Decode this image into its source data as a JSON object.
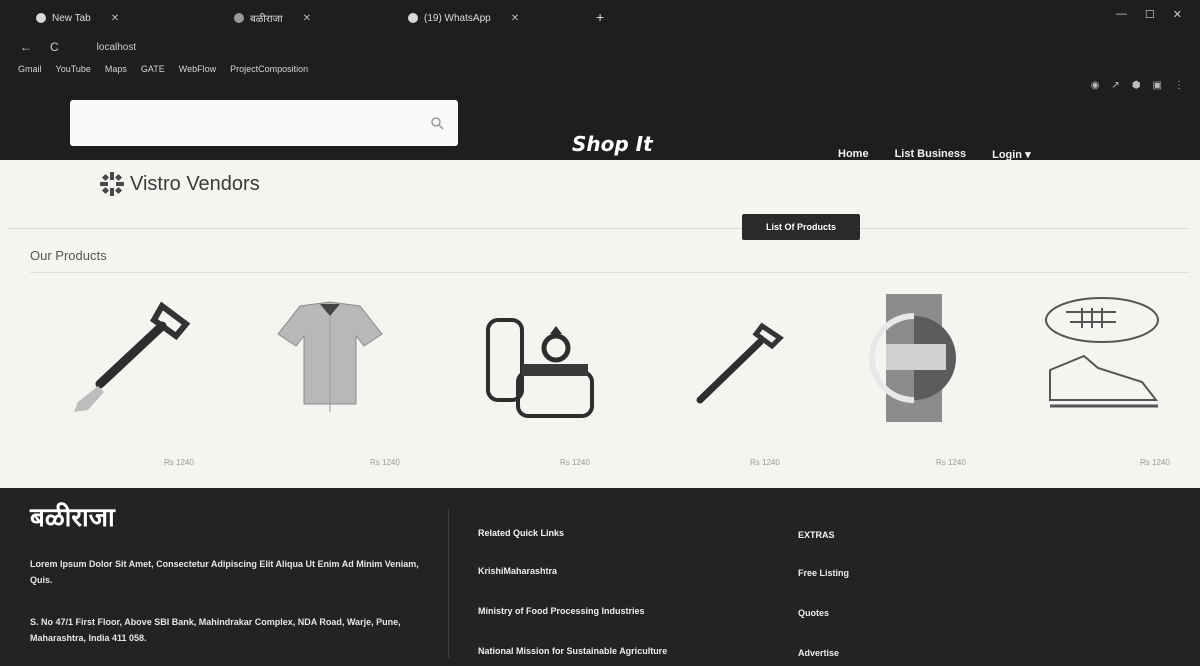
{
  "browser": {
    "tabs": [
      {
        "label": "New Tab"
      },
      {
        "label": "बळीराजा"
      },
      {
        "label": "(19) WhatsApp"
      }
    ],
    "url": "localhost",
    "bookmarks": [
      "Gmail",
      "YouTube",
      "Maps",
      "GATE",
      "WebFlow",
      "ProjectComposition"
    ]
  },
  "site": {
    "search_placeholder": "",
    "brand": "Shop It",
    "nav": {
      "home": "Home",
      "list_business": "List Business",
      "login": "Login ▾"
    },
    "logo_name": "Vistro Vendors",
    "list_products_btn": "List Of Products",
    "section_title": "Our Products"
  },
  "products": [
    {
      "icon": "shovel-icon",
      "name": "",
      "price": "Rs 1240"
    },
    {
      "icon": "shirt-icon",
      "name": "",
      "price": "Rs 1240"
    },
    {
      "icon": "ring-box-icon",
      "name": "",
      "price": "Rs 1240"
    },
    {
      "icon": "shovel-icon",
      "name": "",
      "price": "Rs 1240"
    },
    {
      "icon": "product-image-icon",
      "name": "",
      "price": "Rs 1240"
    },
    {
      "icon": "sneaker-icon",
      "name": "",
      "price": "Rs 1240"
    }
  ],
  "footer": {
    "title": "बळीराजा",
    "about": "Lorem Ipsum Dolor Sit Amet, Consectetur Adipiscing Elit Aliqua Ut Enim Ad Minim Veniam, Quis.",
    "address": "S. No 47/1 First Floor, Above SBI Bank, Mahindrakar Complex, NDA Road, Warje, Pune, Maharashtra, India 411 058.",
    "quick_links": {
      "heading": "Related Quick Links",
      "items": [
        "KrishiMaharashtra",
        "Ministry of Food Processing Industries",
        "National Mission for Sustainable Agriculture"
      ]
    },
    "extras": {
      "heading": "EXTRAS",
      "items": [
        "Free Listing",
        "Quotes",
        "Advertise"
      ]
    }
  },
  "colors": {
    "chrome_bg": "#1e1e1e",
    "footer_bg": "#232323",
    "button_bg": "#2a2a2a",
    "page_bg": "#f4f4f1"
  }
}
